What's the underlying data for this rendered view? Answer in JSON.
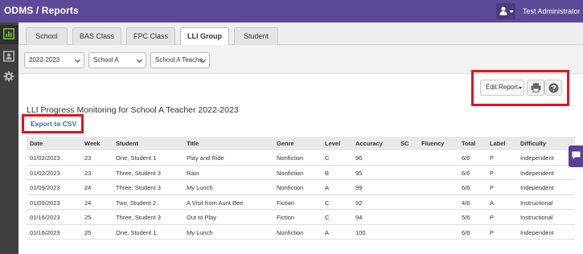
{
  "header": {
    "app_title": "ODMS / Reports",
    "user_name": "Test Administrator",
    "user_icon": "user-icon"
  },
  "sidebar": {
    "items": [
      {
        "icon": "bar-chart-icon",
        "active": true
      },
      {
        "icon": "id-card-icon",
        "active": false
      },
      {
        "icon": "gear-icon",
        "active": false
      }
    ]
  },
  "tabs": [
    {
      "label": "School"
    },
    {
      "label": "BAS Class"
    },
    {
      "label": "FPC Class"
    },
    {
      "label": "LLI Group",
      "active": true
    },
    {
      "label": "Student"
    }
  ],
  "filters": {
    "year": "2022-2023",
    "school": "School A",
    "teacher": "School A Teache"
  },
  "toolbar": {
    "edit_report_label": "Edit Report",
    "print_icon": "print-icon",
    "help_icon": "question-circle-icon"
  },
  "report": {
    "title": "LLI Progress Monitoring for School A Teacher 2022-2023",
    "export_label": "Export to CSV"
  },
  "table": {
    "columns": [
      "Date",
      "Week",
      "Student",
      "Title",
      "Genre",
      "Level",
      "Accuracy",
      "SC",
      "Fluency",
      "Total",
      "Label",
      "Difficulty"
    ],
    "rows": [
      [
        "01/02/2023",
        "23",
        "One, Student 1",
        "Play and Ride",
        "Nonfiction",
        "C",
        "96",
        "",
        "",
        "6/6",
        "P",
        "Independent"
      ],
      [
        "01/02/2023",
        "23",
        "Three, Student 3",
        "Rain",
        "Nonfiction",
        "B",
        "95",
        "",
        "",
        "6/6",
        "P",
        "Independent"
      ],
      [
        "01/09/2023",
        "24",
        "Three, Student 3",
        "My Lunch",
        "Nonfiction",
        "A",
        "99",
        "",
        "",
        "6/6",
        "P",
        "Independent"
      ],
      [
        "01/09/2023",
        "24",
        "Two, Student 2",
        "A Visit from Aunt Bee",
        "Fiction",
        "C",
        "92",
        "",
        "",
        "4/6",
        "A",
        "Instructional"
      ],
      [
        "01/16/2023",
        "25",
        "Three, Student 3",
        "Out to Play",
        "Fiction",
        "C",
        "94",
        "",
        "",
        "5/6",
        "P",
        "Instructional"
      ],
      [
        "01/16/2023",
        "25",
        "One, Student 1",
        "My Lunch",
        "Nonfiction",
        "A",
        "100",
        "",
        "",
        "6/6",
        "P",
        "Independent"
      ]
    ]
  },
  "colors": {
    "header_bg": "#5d4a97",
    "sidebar_bg": "#3f3f3f",
    "highlight_red": "#e0141f",
    "link_blue": "#2f6fb6",
    "chat_widget": "#5d3f96"
  },
  "chat_icon": "chat-bubble-icon"
}
